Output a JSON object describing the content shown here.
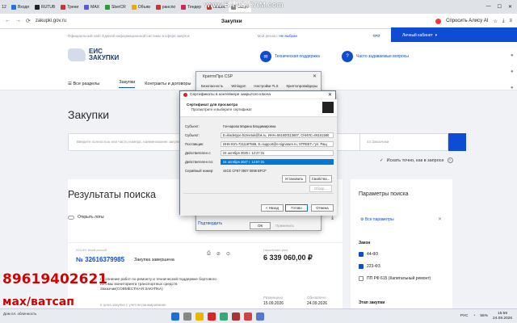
{
  "browser": {
    "tab_counter": "12",
    "tabs": [
      {
        "label": "Входя",
        "color": "#1a73e8"
      },
      {
        "label": "RUTUB",
        "color": "#222"
      },
      {
        "label": "Трени",
        "color": "#c33"
      },
      {
        "label": "MAX",
        "color": "#5b5bd6"
      },
      {
        "label": "SberCR",
        "color": "#21a038"
      },
      {
        "label": "Объяв",
        "color": "#f0a800"
      },
      {
        "label": "ранспо",
        "color": "#c33"
      },
      {
        "label": "Тендер",
        "color": "#d1245a"
      },
      {
        "label": "Комме",
        "color": "#c33"
      },
      {
        "label": "Закуп",
        "color": "#888"
      }
    ],
    "recorder_text": "www.BANDICAM.com",
    "url": "zakupki.gov.ru",
    "page_title": "Закупки",
    "ask_alice": "Спросить Алису AI",
    "win_controls": [
      "—",
      "☐",
      "✕"
    ]
  },
  "site": {
    "official_text": "Официальный сайт Единой информационной системы в сфере закупок",
    "region_label": "Мой регион:",
    "region_value": "Не выбран",
    "cabinet": "Личный кабинет",
    "logo_line1": "ЕИС",
    "logo_line2": "ЗАКУПКИ",
    "support1": "Техническая поддержка",
    "support2": "Часто задаваемые вопросы",
    "menu": [
      "Все разделы",
      "Закупки",
      "Контракты и договоры",
      "Пл"
    ],
    "heading": "Закупки",
    "search_placeholder": "Введите полностью или часть номера, наименования закупки",
    "search_placeholder2": "44 Заказчики",
    "exact_search": "Искать точно, как в запросе",
    "results_title": "Результаты поиска",
    "open_lots": "Открыть лоты",
    "card": {
      "law": "223-ФЗ Иной способ",
      "number": "№ 32616379985",
      "status": "Закупка завершена",
      "desc": "ыполнение работ по ремонту и технической поддержке бортового истемы мониторинга транспортных средств Заказчик(СОВМЕСТНАЯ ЗАКУПКА)",
      "desc_tail": "я цена закупки с учетом ранжирование",
      "price_label": "Начальная цена",
      "price": "6 339 060,00 ₽",
      "date1_label": "Размещено",
      "date1": "15.09.2026",
      "date2_label": "Обновлено",
      "date2": "24.09.2026"
    },
    "params": {
      "title": "Параметры поиска",
      "all": "Все параметры",
      "law_title": "Закон",
      "law_items": [
        {
          "label": "44-ФЗ",
          "checked": true
        },
        {
          "label": "223-ФЗ",
          "checked": true
        },
        {
          "label": "ПП РФ 615 (Капитальный ремонт)",
          "checked": false
        }
      ],
      "stage_title": "Этап закупки"
    }
  },
  "dialog_back": {
    "title": "КриптоПро CSP",
    "tabs": [
      "Безопасность",
      "Winlogon",
      "Настройки TLS",
      "Криптопровайдеры"
    ],
    "link": "Подтвердить",
    "ok": "ОК",
    "apply": "Применить"
  },
  "dialog": {
    "title": "Сертификаты в контейнере закрытого ключа",
    "header_title": "Сертификат для просмотра",
    "header_sub": "Просмотрите и выберите сертификат",
    "fields": [
      {
        "label": "Субъект:",
        "value": "Гончарова Марина Владимировна",
        "style": "plain"
      },
      {
        "label": "Субъект:",
        "value": "E=kladetype.hizmetuk@bk.ru, ИНН=561600113607, СНИЛС=06161580",
        "style": "box"
      },
      {
        "label": "Поставщик:",
        "value": "ИНН ЮЛ=7311187586, E=support@e-signature.ru, STREET=\"ул. Ращ",
        "style": "box"
      },
      {
        "label": "Действителен с:",
        "value": "24 октября 2025 г. 12:47:31",
        "style": "box"
      },
      {
        "label": "Действителен по:",
        "value": "24 октября 2027 г. 12:57:31",
        "style": "sel"
      },
      {
        "label": "Серийный номер:",
        "value": "44CE CF87 0907 0098 BFCF",
        "style": "plain"
      }
    ],
    "install": "Установить",
    "properties": "Свойства...",
    "review": "Обзор...",
    "back": "< Назад",
    "done": "Готово",
    "cancel": "Отмена"
  },
  "overlay": {
    "phone": "89619402621",
    "messengers": "мах/ватсап"
  },
  "taskbar": {
    "weather": "Дом пл. облачность",
    "lang": "РУС",
    "battery": "56%",
    "time": "15:59",
    "date": "24.09.2026"
  },
  "colors": {
    "brand_blue": "#0d4cd3",
    "overlay_red": "#d40000",
    "selection": "#0078d7"
  }
}
